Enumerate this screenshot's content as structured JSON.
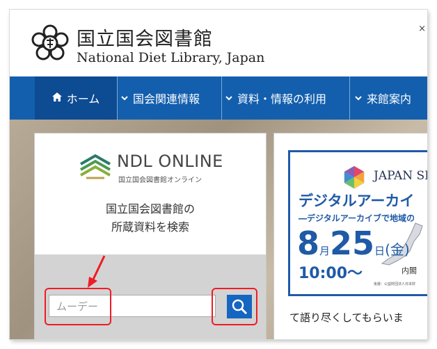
{
  "header": {
    "title_ja": "国立国会図書館",
    "title_en": "National Diet Library, Japan",
    "edge_glyph": "×"
  },
  "nav": {
    "items": [
      {
        "label": "ホーム",
        "icon": "home-icon"
      },
      {
        "label": "国会関連情報",
        "icon": "chevron-down-icon"
      },
      {
        "label": "資料・情報の利用",
        "icon": "chevron-down-icon"
      },
      {
        "label": "来館案内",
        "icon": "chevron-down-icon"
      }
    ]
  },
  "search_card": {
    "brand": "NDL ONLINE",
    "brand_sub": "国立国会図書館オンライン",
    "description_line1": "国立国会図書館の",
    "description_line2": "所蔵資料を検索",
    "input_value": "ムーデー",
    "search_icon": "search-icon"
  },
  "event": {
    "brand": "JAPAN SE",
    "title": "デジタルアーカイ",
    "subtitle": "―デジタルアーカイブで地域の",
    "date_month": "8",
    "date_month_unit": "月",
    "date_day": "25",
    "date_day_unit": "日",
    "date_weekday": "(金)",
    "time": "10:00～",
    "place": "内閣",
    "org": "後援：公益財団法人日本財",
    "text": "て語り尽くしてもらいま"
  },
  "colors": {
    "nav_bg": "#135fae",
    "nav_home_bg": "#0d4b93",
    "search_button": "#1466c0",
    "annotation": "#ee1c25",
    "banner_blue": "#1f5aa6"
  }
}
